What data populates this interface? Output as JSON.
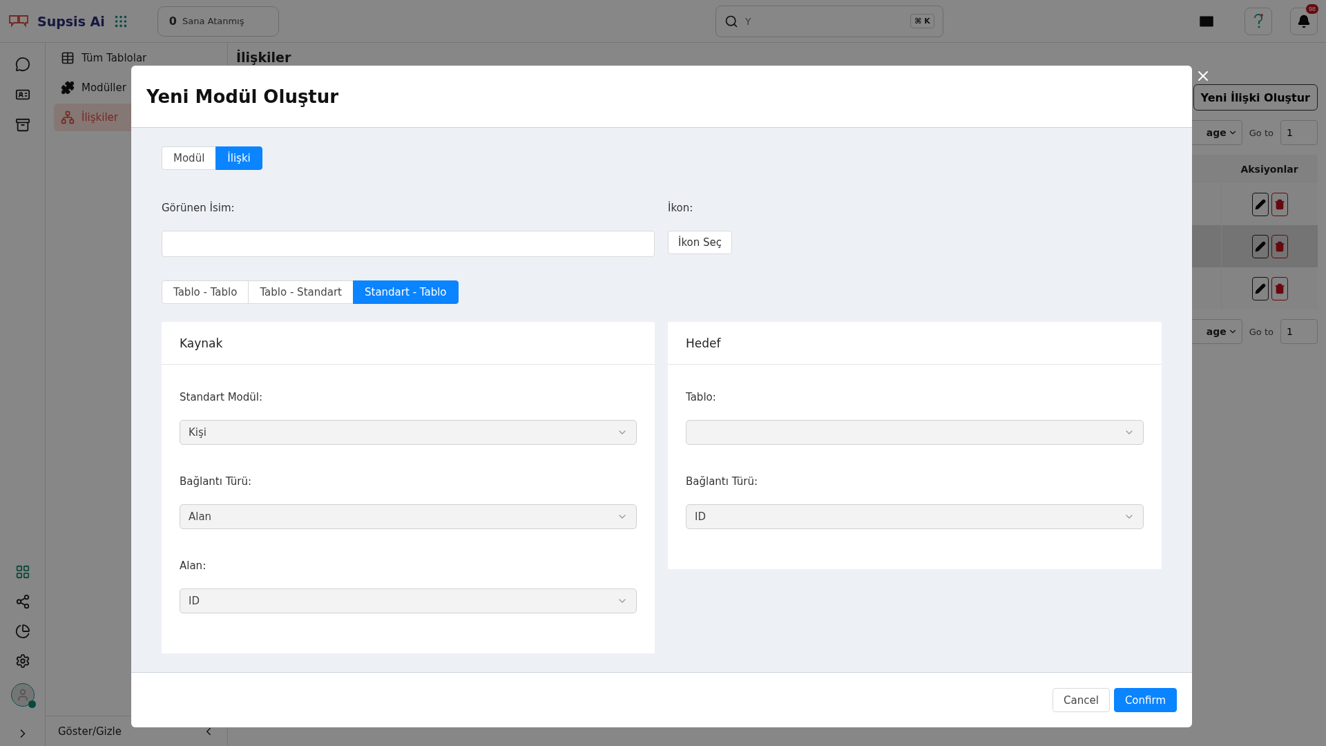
{
  "header": {
    "brand": "Supsis Ai",
    "assigned": {
      "count": "0",
      "label": "Sana Atanmış"
    },
    "search": {
      "placeholder": "Y",
      "shortcut": "⌘ K"
    },
    "notifications": {
      "count": "98"
    }
  },
  "sidebar": {
    "items": [
      {
        "label": "Tüm Tablolar",
        "selected": false
      },
      {
        "label": "Modüller",
        "selected": false
      },
      {
        "label": "İlişkiler",
        "selected": true
      }
    ],
    "footer": "Göster/Gizle"
  },
  "page": {
    "title": "İlişkiler",
    "create_button": "Yeni İlişki Oluştur",
    "pagination": [
      {
        "page_select": "age",
        "goto_label": "Go to",
        "goto_value": "1"
      },
      {
        "page_select": "age",
        "goto_label": "Go to",
        "goto_value": "1"
      }
    ],
    "table": {
      "columns": [
        "Aksiyonlar"
      ],
      "rows": [
        {
          "striped": false
        },
        {
          "striped": true
        },
        {
          "striped": false
        }
      ]
    }
  },
  "modal": {
    "title": "Yeni Modül Oluştur",
    "type_tabs": [
      {
        "label": "Modül",
        "selected": false
      },
      {
        "label": "İlişki",
        "selected": true
      }
    ],
    "name_label": "Görünen İsim:",
    "icon_label": "İkon:",
    "icon_button": "İkon Seç",
    "relation_tabs": [
      {
        "label": "Tablo - Tablo",
        "selected": false
      },
      {
        "label": "Tablo - Standart",
        "selected": false
      },
      {
        "label": "Standart - Tablo",
        "selected": true
      }
    ],
    "cards": [
      {
        "title": "Kaynak",
        "fields": [
          {
            "label": "Standart Modül:",
            "value": "Kişi"
          },
          {
            "label": "Bağlantı Türü:",
            "value": "Alan"
          },
          {
            "label": "Alan:",
            "value": "ID"
          }
        ]
      },
      {
        "title": "Hedef",
        "fields": [
          {
            "label": "Tablo:"
          },
          {
            "label": "Bağlantı Türü:",
            "value": "ID"
          }
        ]
      }
    ],
    "buttons": [
      {
        "label": "Cancel",
        "kind": "default"
      },
      {
        "label": "Confirm",
        "kind": "primary"
      }
    ]
  }
}
